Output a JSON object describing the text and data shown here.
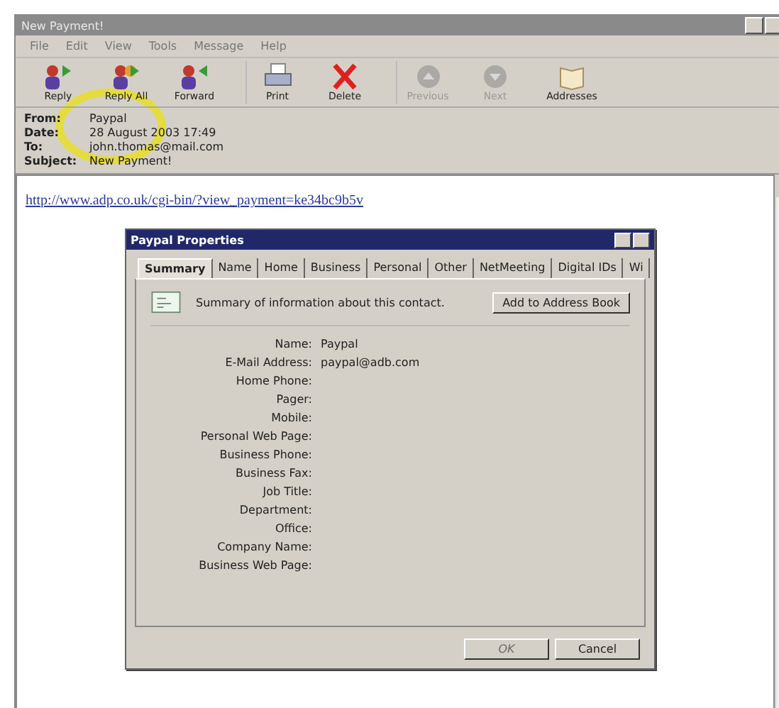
{
  "window": {
    "title": "New Payment!"
  },
  "menu": [
    "File",
    "Edit",
    "View",
    "Tools",
    "Message",
    "Help"
  ],
  "toolbar": [
    {
      "kind": "reply",
      "label": "Reply",
      "disabled": false
    },
    {
      "kind": "reply-all",
      "label": "Reply All",
      "disabled": false
    },
    {
      "kind": "forward",
      "label": "Forward",
      "disabled": false
    },
    {
      "kind": "print",
      "label": "Print",
      "disabled": false
    },
    {
      "kind": "delete",
      "label": "Delete",
      "disabled": false
    },
    {
      "kind": "previous",
      "label": "Previous",
      "disabled": true
    },
    {
      "kind": "next",
      "label": "Next",
      "disabled": true
    },
    {
      "kind": "addresses",
      "label": "Addresses",
      "disabled": false
    }
  ],
  "headers": [
    {
      "label": "From:",
      "value": "Paypal"
    },
    {
      "label": "Date:",
      "value": "28 August 2003 17:49"
    },
    {
      "label": "To:",
      "value": "john.thomas@mail.com"
    },
    {
      "label": "Subject:",
      "value": "New Payment!"
    }
  ],
  "body": {
    "link": "http://www.adp.co.uk/cgi-bin/?view_payment=ke34bc9b5v"
  },
  "dialog": {
    "title": "Paypal Properties",
    "tabs": [
      {
        "label": "Summary",
        "selected": true
      },
      {
        "label": "Name",
        "selected": false
      },
      {
        "label": "Home",
        "selected": false
      },
      {
        "label": "Business",
        "selected": false
      },
      {
        "label": "Personal",
        "selected": false
      },
      {
        "label": "Other",
        "selected": false
      },
      {
        "label": "NetMeeting",
        "selected": false
      },
      {
        "label": "Digital IDs",
        "selected": false
      },
      {
        "label": "Wi",
        "selected": false
      }
    ],
    "summary": "Summary of information about this contact.",
    "add_button": "Add to Address Book",
    "fields": [
      {
        "label": "Name:",
        "value": "Paypal"
      },
      {
        "label": "E-Mail Address:",
        "value": "paypal@adb.com"
      },
      {
        "label": "Home Phone:"
      },
      {
        "label": "Pager:"
      },
      {
        "label": "Mobile:"
      },
      {
        "label": "Personal Web Page:"
      },
      {
        "label": "Business Phone:"
      },
      {
        "label": "Business Fax:"
      },
      {
        "label": "Job Title:"
      },
      {
        "label": "Department:"
      },
      {
        "label": "Office:"
      },
      {
        "label": "Company Name:"
      },
      {
        "label": "Business Web Page:"
      }
    ],
    "buttons": [
      {
        "label": "OK",
        "disabled": true
      },
      {
        "label": "Cancel",
        "disabled": false
      }
    ]
  }
}
